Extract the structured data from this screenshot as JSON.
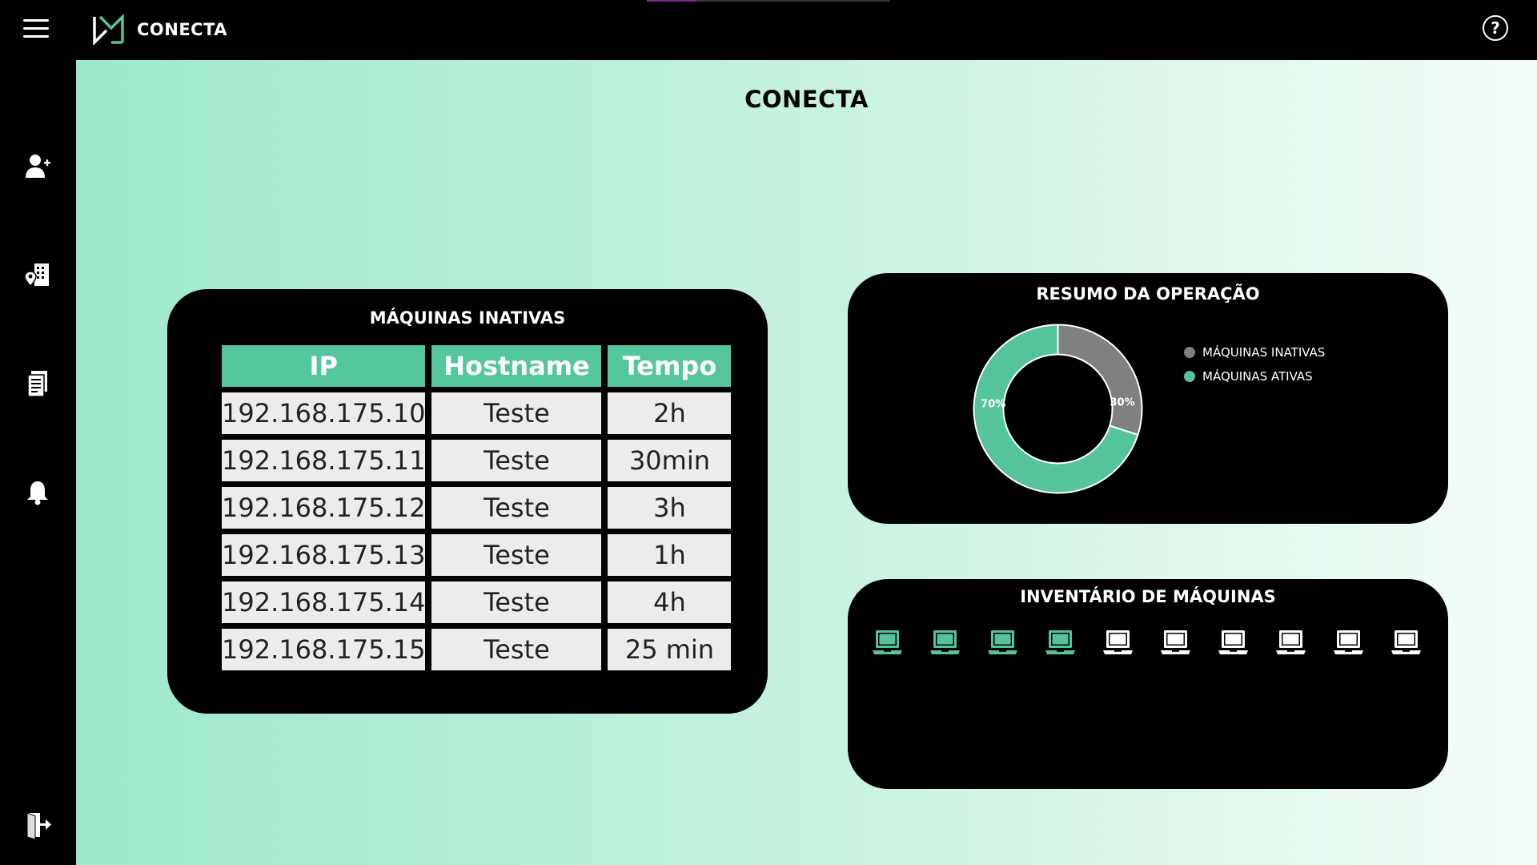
{
  "app": {
    "brand": "CONECTA",
    "page_title": "CONECTA"
  },
  "icons": {
    "menu": "hamburger-icon",
    "help": "help-circle-icon",
    "sidebar": [
      "user-add-icon",
      "building-location-icon",
      "document-icon",
      "bell-icon",
      "logout-icon"
    ]
  },
  "help_label": "?",
  "inactive_card": {
    "title": "MÁQUINAS INATIVAS",
    "headers": [
      "IP",
      "Hostname",
      "Tempo"
    ],
    "rows": [
      [
        "192.168.175.10",
        "Teste",
        "2h"
      ],
      [
        "192.168.175.11",
        "Teste",
        "30min"
      ],
      [
        "192.168.175.12",
        "Teste",
        "3h"
      ],
      [
        "192.168.175.13",
        "Teste",
        "1h"
      ],
      [
        "192.168.175.14",
        "Teste",
        "4h"
      ],
      [
        "192.168.175.15",
        "Teste",
        "25 min"
      ]
    ]
  },
  "summary_card": {
    "title": "RESUMO DA OPERAÇÃO",
    "slices": [
      {
        "label": "MÁQUINAS INATIVAS",
        "value": 30,
        "display": "30%",
        "color": "#808080"
      },
      {
        "label": "MÁQUINAS ATIVAS",
        "value": 70,
        "display": "70%",
        "color": "#55c49a"
      }
    ]
  },
  "inventory_card": {
    "title": "INVENTÁRIO DE MÁQUINAS",
    "machines": [
      "active",
      "active",
      "active",
      "active",
      "inactive",
      "inactive",
      "inactive",
      "inactive",
      "inactive",
      "inactive"
    ],
    "active_color": "#55c49a",
    "inactive_color": "#ffffff"
  }
}
